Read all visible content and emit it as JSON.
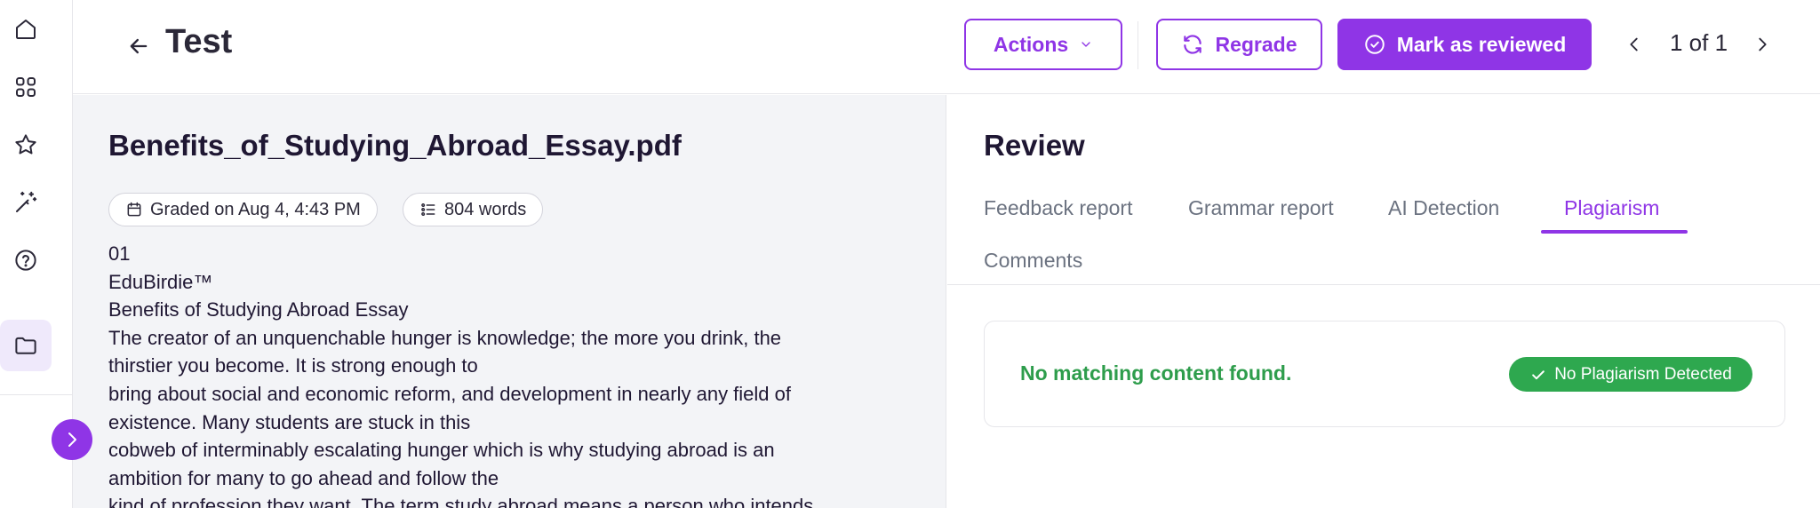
{
  "header": {
    "title": "Test",
    "actions_label": "Actions",
    "regrade_label": "Regrade",
    "mark_reviewed_label": "Mark as reviewed",
    "pager_text": "1 of 1"
  },
  "sidebar": {
    "items": [
      {
        "icon": "home-icon"
      },
      {
        "icon": "grid-icon"
      },
      {
        "icon": "star-icon"
      },
      {
        "icon": "magic-wand-icon"
      },
      {
        "icon": "help-icon"
      },
      {
        "icon": "folder-icon",
        "active": true
      }
    ],
    "expand_icon": "chevron-right-icon"
  },
  "document": {
    "filename": "Benefits_of_Studying_Abroad_Essay.pdf",
    "graded_on": "Graded on Aug 4, 4:43 PM",
    "word_count": "804 words",
    "lines": [
      "01",
      "EduBirdie™",
      "Benefits of Studying Abroad Essay",
      "The creator of an unquenchable hunger is knowledge; the more you drink, the",
      "thirstier you become. It is strong enough to",
      "bring about social and economic reform, and development in nearly any field of",
      "existence. Many students are stuck in this",
      "cobweb of interminably escalating hunger which is why studying abroad is an",
      "ambition for many to go ahead and follow the",
      "kind of profession they want. The term study abroad means a person who intends"
    ]
  },
  "review": {
    "title": "Review",
    "tabs": [
      {
        "label": "Feedback report"
      },
      {
        "label": "Grammar report"
      },
      {
        "label": "AI Detection"
      },
      {
        "label": "Plagiarism",
        "active": true
      },
      {
        "label": "Comments"
      }
    ],
    "result_message": "No matching content found.",
    "badge_label": "No Plagiarism Detected"
  },
  "colors": {
    "accent": "#8f35e6",
    "success_text": "#2e9d4c",
    "success_badge": "#2ea84f",
    "pane_background": "#f3f4f7"
  }
}
